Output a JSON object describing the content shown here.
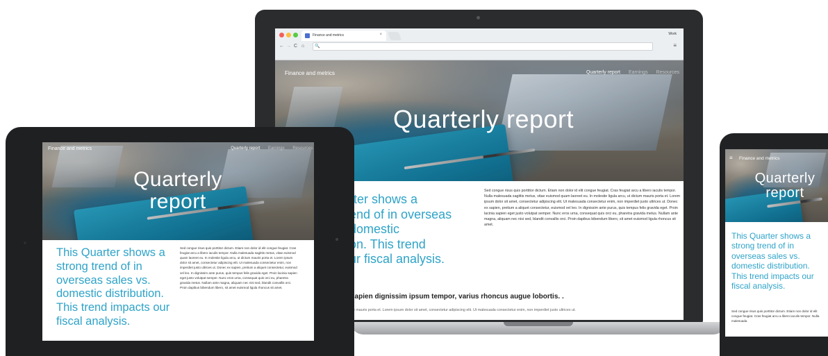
{
  "site": {
    "brand": "Finance and metrics",
    "nav": [
      "Quarterly report",
      "Earnings",
      "Resources"
    ],
    "hero_title": "Quarterly report",
    "hero_title_line1": "Quarterly",
    "hero_title_line2": "report",
    "lead_full": "This Quarter shows a strong trend of in overseas sales vs. domestic distribution. This trend impacts our fiscal analysis.",
    "lead_laptop": "rter shows a\nend of in overseas\ndomestic\non. This trend\nur fiscal analysis.",
    "body_text": "Sed congue risus quis porttitor dictum. Etiam non dolor id elit congue feugiat. Cras feugiat arcu a libero iaculis tempor. Nulla malesuada sagittis metus, vitae euismod quam laoreet eu. In molestie ligula arcu, ut dictum mauris porta et. Lorem ipsum dolor sit amet, consectetur adipiscing elit. Ut malesuada consectetur enim, non imperdiet justo ultrices ut. Donec ex sapien, pretium a aliquet consectetur, euismod vel leo. In dignissim ante purus, quis tempus felis gravida eget. Proin lacinia sapien eget justo volutpat semper. Nunc eros urna, consequat quis orci eu, pharetra gravida metus. Nullam ante magna, aliquam nec nisi sed, blandit convallis orci. Proin dapibus bibendum libero, sit amet euismod ligula rhoncus sit amet.",
    "phone_body_text": "Sed congue risus quis porttitor dictum. Etiam non dolor id elit congue feugiat. Cras feugiat arcu a libero iaculis tempor. Nulla malesuada",
    "subhead": "sapien dignissim ipsum tempor, varius rhoncus augue lobortis. .",
    "subhead_body": "ue mauris porta et. Lorem ipsum dolor sit amet, consectetur adipiscing elit. Ut malesuada consectetur enim, non imperdiet justo ultrices ut."
  },
  "browser": {
    "tab_title": "Finance and metrics",
    "tab_close": "×",
    "profile": "Work",
    "back": "←",
    "forward": "→",
    "reload": "C",
    "home": "⌂",
    "search": "🔍",
    "menu": "≡"
  },
  "phone": {
    "menu_icon": "≡"
  },
  "colors": {
    "accent": "#2ea3c8",
    "device": "#2b2c2e"
  }
}
